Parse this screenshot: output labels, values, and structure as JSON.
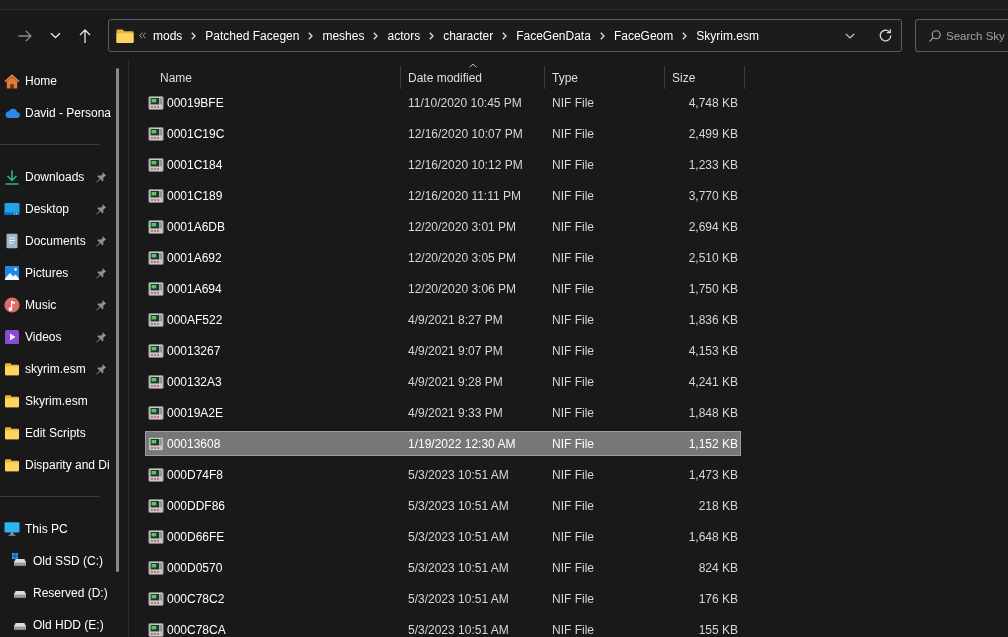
{
  "toolbar": {
    "nav_buttons": [
      {
        "kind": "forward",
        "disabled": true
      },
      {
        "kind": "recent",
        "disabled": false
      },
      {
        "kind": "up",
        "disabled": false
      }
    ],
    "address_bar": {
      "collapsed": true,
      "path": [
        "mods",
        "Patched Facegen",
        "meshes",
        "actors",
        "character",
        "FaceGenData",
        "FaceGeom",
        "Skyrim.esm"
      ]
    },
    "search": {
      "placeholder": "Search Sky"
    }
  },
  "sidebar": {
    "groups": [
      {
        "items": [
          {
            "kind": "home",
            "label": "Home"
          },
          {
            "kind": "cloud",
            "label": "David - Persona"
          }
        ]
      },
      {
        "items": [
          {
            "kind": "downloads",
            "label": "Downloads",
            "pinned": true
          },
          {
            "kind": "desktop",
            "label": "Desktop",
            "pinned": true
          },
          {
            "kind": "documents",
            "label": "Documents",
            "pinned": true
          },
          {
            "kind": "pictures",
            "label": "Pictures",
            "pinned": true
          },
          {
            "kind": "music",
            "label": "Music",
            "pinned": true
          },
          {
            "kind": "videos",
            "label": "Videos",
            "pinned": true
          },
          {
            "kind": "folder",
            "label": "skyrim.esm",
            "pinned": true
          },
          {
            "kind": "folder",
            "label": "Skyrim.esm",
            "pinned": false
          },
          {
            "kind": "folder",
            "label": "Edit Scripts",
            "pinned": false
          },
          {
            "kind": "folder",
            "label": "Disparity and Di",
            "pinned": false
          }
        ]
      },
      {
        "items": [
          {
            "kind": "pc",
            "label": "This PC",
            "children": [
              {
                "kind": "system_drive",
                "label": "Old SSD (C:)"
              },
              {
                "kind": "drive",
                "label": "Reserved (D:)"
              },
              {
                "kind": "drive",
                "label": "Old HDD (E:)"
              }
            ]
          }
        ]
      }
    ]
  },
  "file_list": {
    "columns": [
      {
        "label": "Name",
        "sorted": false
      },
      {
        "label": "Date modified",
        "sorted": true
      },
      {
        "label": "Type",
        "sorted": false
      },
      {
        "label": "Size",
        "sorted": false
      }
    ],
    "rows": [
      {
        "name": "00019BFE",
        "date": "11/10/2020 10:45 PM",
        "type": "NIF File",
        "size": "4,748 KB",
        "selected": false
      },
      {
        "name": "0001C19C",
        "date": "12/16/2020 10:07 PM",
        "type": "NIF File",
        "size": "2,499 KB",
        "selected": false
      },
      {
        "name": "0001C184",
        "date": "12/16/2020 10:12 PM",
        "type": "NIF File",
        "size": "1,233 KB",
        "selected": false
      },
      {
        "name": "0001C189",
        "date": "12/16/2020 11:11 PM",
        "type": "NIF File",
        "size": "3,770 KB",
        "selected": false
      },
      {
        "name": "0001A6DB",
        "date": "12/20/2020 3:01 PM",
        "type": "NIF File",
        "size": "2,694 KB",
        "selected": false
      },
      {
        "name": "0001A692",
        "date": "12/20/2020 3:05 PM",
        "type": "NIF File",
        "size": "2,510 KB",
        "selected": false
      },
      {
        "name": "0001A694",
        "date": "12/20/2020 3:06 PM",
        "type": "NIF File",
        "size": "1,750 KB",
        "selected": false
      },
      {
        "name": "000AF522",
        "date": "4/9/2021 8:27 PM",
        "type": "NIF File",
        "size": "1,836 KB",
        "selected": false
      },
      {
        "name": "00013267",
        "date": "4/9/2021 9:07 PM",
        "type": "NIF File",
        "size": "4,153 KB",
        "selected": false
      },
      {
        "name": "000132A3",
        "date": "4/9/2021 9:28 PM",
        "type": "NIF File",
        "size": "4,241 KB",
        "selected": false
      },
      {
        "name": "00019A2E",
        "date": "4/9/2021 9:33 PM",
        "type": "NIF File",
        "size": "1,848 KB",
        "selected": false
      },
      {
        "name": "00013608",
        "date": "1/19/2022 12:30 AM",
        "type": "NIF File",
        "size": "1,152 KB",
        "selected": true
      },
      {
        "name": "000D74F8",
        "date": "5/3/2023 10:51 AM",
        "type": "NIF File",
        "size": "1,473 KB",
        "selected": false
      },
      {
        "name": "000DDF86",
        "date": "5/3/2023 10:51 AM",
        "type": "NIF File",
        "size": "218 KB",
        "selected": false
      },
      {
        "name": "000D66FE",
        "date": "5/3/2023 10:51 AM",
        "type": "NIF File",
        "size": "1,648 KB",
        "selected": false
      },
      {
        "name": "000D0570",
        "date": "5/3/2023 10:51 AM",
        "type": "NIF File",
        "size": "824 KB",
        "selected": false
      },
      {
        "name": "000C78C2",
        "date": "5/3/2023 10:51 AM",
        "type": "NIF File",
        "size": "176 KB",
        "selected": false
      },
      {
        "name": "000C78CA",
        "date": "5/3/2023 10:51 AM",
        "type": "NIF File",
        "size": "155 KB",
        "selected": false
      }
    ]
  }
}
